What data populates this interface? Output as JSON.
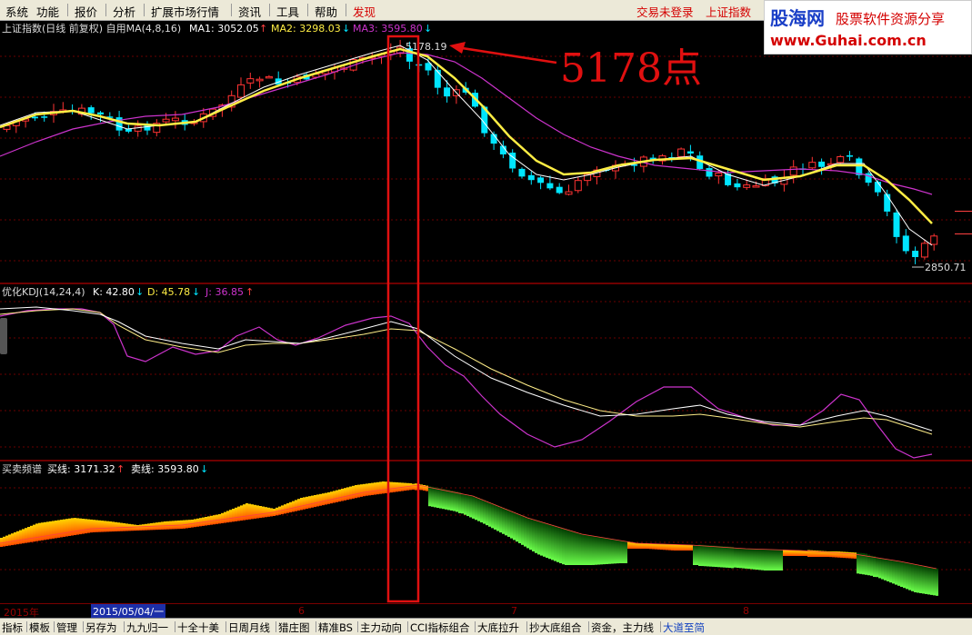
{
  "menu": {
    "items": [
      "系统",
      "功能",
      "报价",
      "分析",
      "扩展市场行情",
      "资讯",
      "工具",
      "帮助",
      "发现"
    ],
    "login_status": "交易未登录",
    "current_index": "上证指数"
  },
  "logo": {
    "brand": "股海网",
    "slogan": "股票软件资源分享",
    "url": "www.Guhai.com.cn"
  },
  "price_panel": {
    "title": "上证指数(日线 前复权) 自用MA(4,8,16)",
    "ma1_label": "MA1: 3052.05",
    "ma2_label": "MA2: 3298.03",
    "ma3_label": "MA3: 3595.80",
    "peak_label": "5178.19",
    "low_label": "2850.71",
    "annotation": "5178点"
  },
  "kdj_panel": {
    "title": "优化KDJ(14,24,4)",
    "k_label": "K: 42.80",
    "d_label": "D: 45.78",
    "j_label": "J: 36.85"
  },
  "spectrum_panel": {
    "title": "买卖频谱",
    "buy_label": "买线: 3171.32",
    "sell_label": "卖线: 3593.80"
  },
  "date_axis": {
    "year": "2015年",
    "cursor_date": "2015/05/04/一",
    "months": [
      "6",
      "7",
      "8"
    ]
  },
  "bottom_tabs": [
    "指标",
    "模板",
    "管理",
    "另存为",
    "九九归一",
    "十全十美",
    "日周月线",
    "猎庄图",
    "精准BS",
    "主力动向",
    "CCI指标组合",
    "大底拉升",
    "抄大底组合",
    "资金，主力线",
    "大道至简"
  ],
  "colors": {
    "up_candle": "#ff3333",
    "down_candle": "#00e5ff",
    "ma_yellow": "#ffee44",
    "ma_white": "#ffffff",
    "ma_purple": "#cc33cc",
    "grid": "#7a0000",
    "annotation_red": "#e01010"
  }
}
